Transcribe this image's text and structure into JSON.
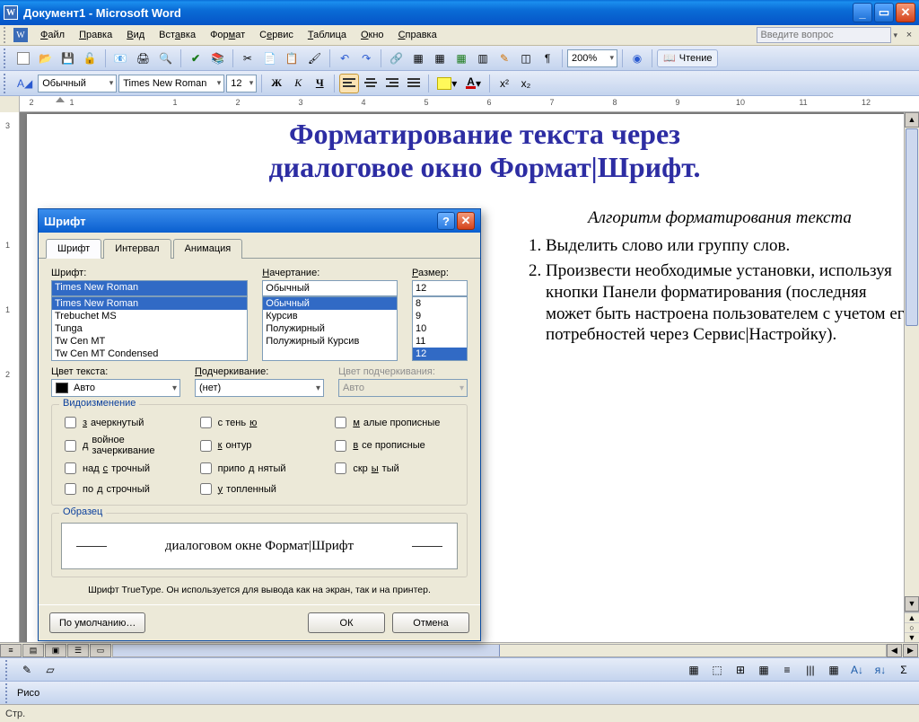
{
  "window": {
    "title": "Документ1 - Microsoft Word"
  },
  "menu": {
    "items": [
      "Файл",
      "Правка",
      "Вид",
      "Вставка",
      "Формат",
      "Сервис",
      "Таблица",
      "Окно",
      "Справка"
    ],
    "ask_placeholder": "Введите вопрос"
  },
  "toolbar1": {
    "zoom": "200%",
    "reading": "Чтение"
  },
  "toolbar2": {
    "style": "Обычный",
    "font": "Times New Roman",
    "size": "12"
  },
  "ruler": {
    "hticks": [
      "2",
      "1",
      "",
      "1",
      "2",
      "3",
      "4",
      "5",
      "6",
      "7",
      "8",
      "9",
      "10",
      "11",
      "12"
    ],
    "vticks": [
      "3",
      "",
      "1",
      "1",
      "2"
    ]
  },
  "document": {
    "title_line1": "Форматирование текста через",
    "title_line2": "диалоговое окно Формат|Шрифт.",
    "algo_heading": "Алгоритм форматирования текста",
    "step1": "Выделить слово или группу слов.",
    "step2": "Произвести необходимые установки, используя кнопки Панели форматирования (последняя может быть настроена пользователем с учетом его потребностей через Сервис|Настройку)."
  },
  "dialog": {
    "title": "Шрифт",
    "tabs": [
      "Шрифт",
      "Интервал",
      "Анимация"
    ],
    "font_label": "Шрифт:",
    "font_value": "Times New Roman",
    "font_list": [
      "Times New Roman",
      "Trebuchet MS",
      "Tunga",
      "Tw Cen MT",
      "Tw Cen MT Condensed"
    ],
    "style_label": "Начертание:",
    "style_value": "Обычный",
    "style_list": [
      "Обычный",
      "Курсив",
      "Полужирный",
      "Полужирный Курсив"
    ],
    "size_label": "Размер:",
    "size_value": "12",
    "size_list": [
      "8",
      "9",
      "10",
      "11",
      "12"
    ],
    "color_label": "Цвет текста:",
    "color_value": "Авто",
    "underline_label": "Подчеркивание:",
    "underline_value": "(нет)",
    "underline_color_label": "Цвет подчеркивания:",
    "underline_color_value": "Авто",
    "effects_legend": "Видоизменение",
    "effects_col1": [
      "зачеркнутый",
      "двойное зачеркивание",
      "надстрочный",
      "подстрочный"
    ],
    "effects_col2": [
      "с тенью",
      "контур",
      "приподнятый",
      "утопленный"
    ],
    "effects_col3": [
      "малые прописные",
      "все прописные",
      "скрытый"
    ],
    "sample_legend": "Образец",
    "sample_text": "диалоговом окне Формат|Шрифт",
    "hint": "Шрифт TrueType. Он используется для вывода как на экран, так и на принтер.",
    "default_btn": "По умолчанию…",
    "ok_btn": "ОК",
    "cancel_btn": "Отмена"
  },
  "bottombar": {
    "draw_label": "Рисо",
    "status": "Стр."
  }
}
